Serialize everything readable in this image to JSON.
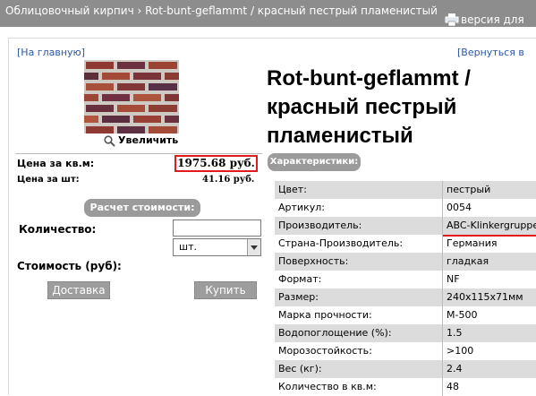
{
  "header": {
    "breadcrumbs": "Облицовочный кирпич › Rot-bunt-geflammt / красный пестрый пламенистый",
    "print_label": "версия для"
  },
  "nav": {
    "home_link": "[На главную]",
    "back_link": "[Вернуться в"
  },
  "product": {
    "title": "Rot-bunt-geflammt / красный пестрый пламенистый",
    "zoom_label": "Увеличить",
    "price_per_m2_label": "Цена за кв.м:",
    "price_per_m2": "1975.68 руб.",
    "price_per_piece_label": "Цена за шт:",
    "price_per_piece": "41.16 руб."
  },
  "calculator": {
    "heading": "Расчет стоимости:",
    "quantity_label": "Количество:",
    "quantity_value": "",
    "unit_selected": "шт.",
    "cost_label": "Стоимость (руб):",
    "delivery_button": "Доставка",
    "buy_button": "Купить"
  },
  "characteristics": {
    "heading": "Характеристики:",
    "rows": [
      {
        "name": "Цвет:",
        "value": "пестрый"
      },
      {
        "name": "Артикул:",
        "value": "0054"
      },
      {
        "name": "Производитель:",
        "value": "ABC-Klinkergruppe"
      },
      {
        "name": "Страна-Производитель:",
        "value": "Германия"
      },
      {
        "name": "Поверхность:",
        "value": "гладкая"
      },
      {
        "name": "Формат:",
        "value": "NF"
      },
      {
        "name": "Размер:",
        "value": "240x115x71мм"
      },
      {
        "name": "Марка прочности:",
        "value": "М-500"
      },
      {
        "name": "Водопоглощение (%):",
        "value": "1.5"
      },
      {
        "name": "Морозостойкость:",
        "value": ">100"
      },
      {
        "name": "Вес (кг):",
        "value": "2.4"
      },
      {
        "name": "Количество в кв.м:",
        "value": "48"
      }
    ]
  },
  "colors": {
    "topbar": "#8d8d8d",
    "link": "#2a56a6",
    "price_border": "#e11b1b",
    "section_heading_bg": "#9b9b9b"
  }
}
